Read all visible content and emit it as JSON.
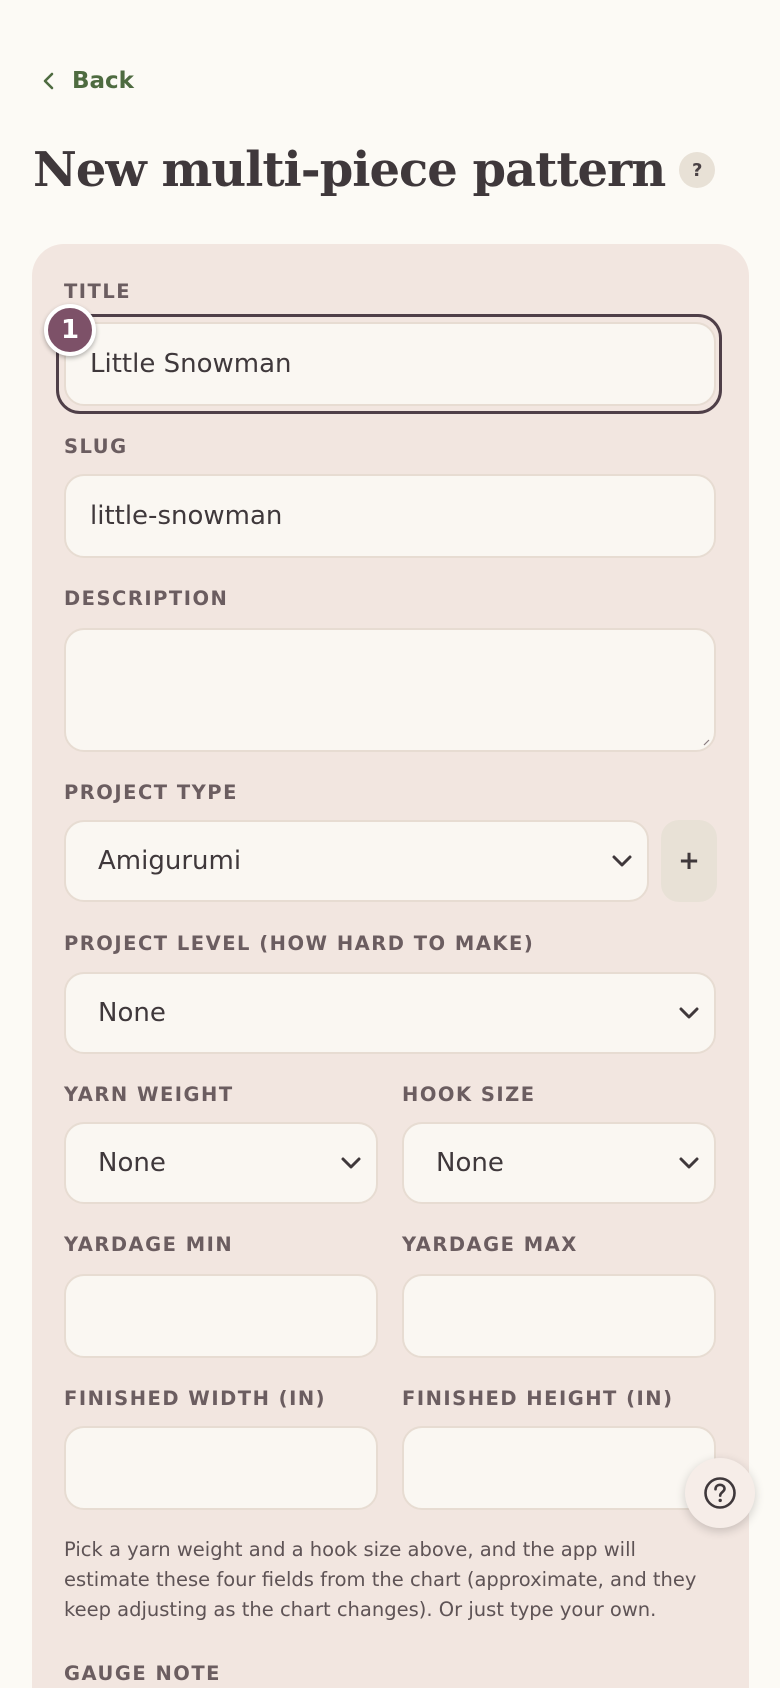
{
  "nav": {
    "back_label": "Back"
  },
  "page": {
    "title": "New multi-piece pattern",
    "help_glyph": "?"
  },
  "form": {
    "title": {
      "label": "TITLE",
      "value": "Little Snowman",
      "step_badge": "1"
    },
    "slug": {
      "label": "SLUG",
      "value": "little-snowman"
    },
    "description": {
      "label": "DESCRIPTION",
      "value": ""
    },
    "project_type": {
      "label": "PROJECT TYPE",
      "selected": "Amigurumi",
      "add_label": "+"
    },
    "project_level": {
      "label": "PROJECT LEVEL (HOW HARD TO MAKE)",
      "selected": "None"
    },
    "yarn_weight": {
      "label": "YARN WEIGHT",
      "selected": "None"
    },
    "hook_size": {
      "label": "HOOK SIZE",
      "selected": "None"
    },
    "yardage_min": {
      "label": "YARDAGE MIN",
      "value": ""
    },
    "yardage_max": {
      "label": "YARDAGE MAX",
      "value": ""
    },
    "finished_width": {
      "label": "FINISHED WIDTH (IN)",
      "value": ""
    },
    "finished_height": {
      "label": "FINISHED HEIGHT (IN)",
      "value": ""
    },
    "estimate_hint": "Pick a yarn weight and a hook size above, and the app will estimate these four fields from the chart (approximate, and they keep adjusting as the chart changes). Or just type your own.",
    "gauge_note": {
      "label": "GAUGE NOTE"
    }
  },
  "icons": {
    "back": "chevron-left-icon",
    "select": "chevron-down-icon",
    "help": "question-circle-icon"
  },
  "colors": {
    "background": "#fcfaf5",
    "card": "#f2e6e0",
    "accent_green": "#4e6b40",
    "badge": "#7d5168",
    "text": "#3f383b"
  }
}
